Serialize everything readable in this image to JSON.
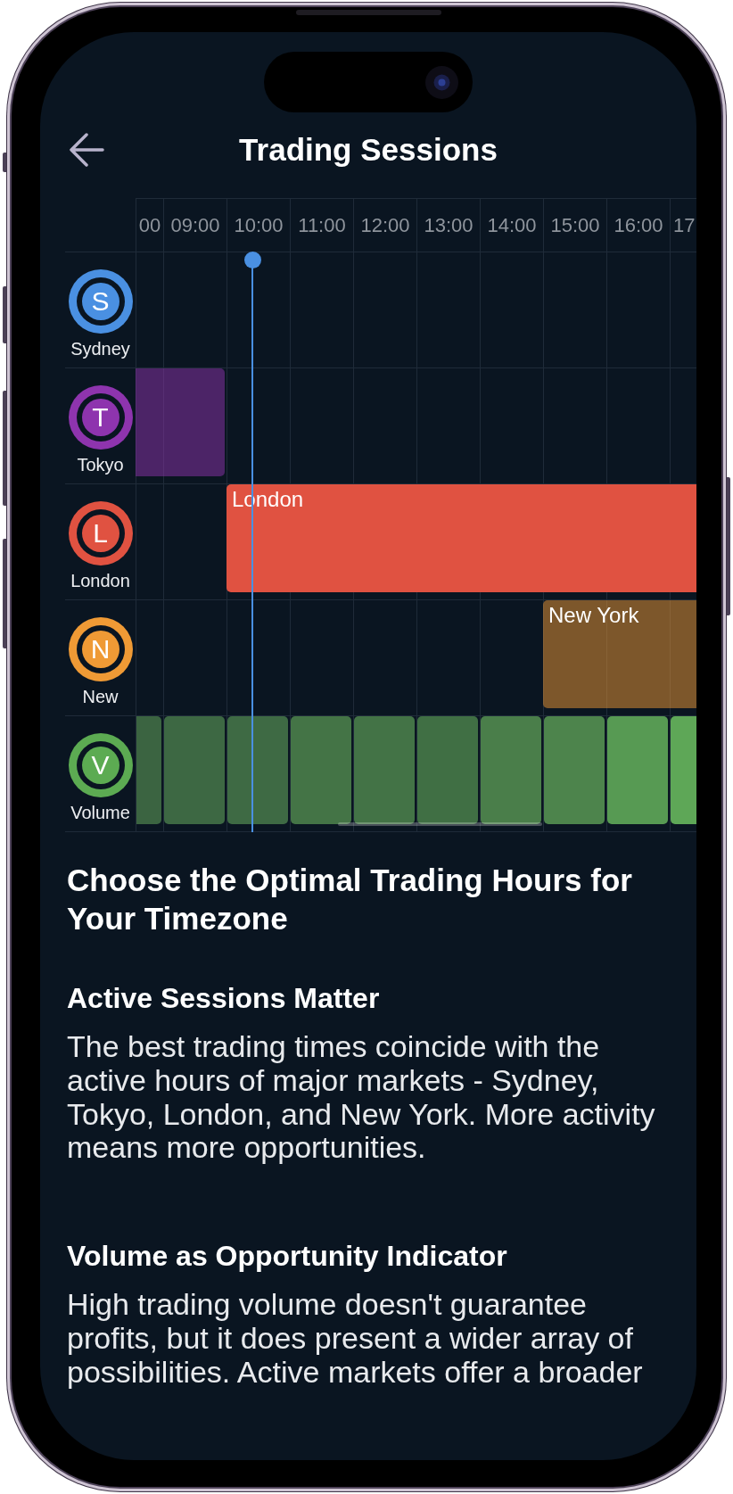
{
  "screen": {
    "title": "Trading Sessions"
  },
  "timeline": {
    "hours": [
      {
        "label": "00",
        "now": false
      },
      {
        "label": "09:00",
        "now": false
      },
      {
        "label": "10:00",
        "now": true
      },
      {
        "label": "11:00",
        "now": false
      },
      {
        "label": "12:00",
        "now": false
      },
      {
        "label": "13:00",
        "now": false
      },
      {
        "label": "14:00",
        "now": false
      },
      {
        "label": "15:00",
        "now": false
      },
      {
        "label": "16:00",
        "now": false
      },
      {
        "label": "17",
        "now": false
      }
    ],
    "rows": [
      {
        "kind": "session",
        "letter": "S",
        "name": "Sydney",
        "color": "#4a90e2",
        "active": [
          false,
          false,
          false,
          false,
          false,
          false,
          false,
          false,
          false,
          false
        ]
      },
      {
        "kind": "session",
        "letter": "T",
        "name": "Tokyo",
        "color": "#8e34ae",
        "open_now": false,
        "active": [
          true,
          true,
          false,
          false,
          false,
          false,
          false,
          false,
          false,
          false
        ]
      },
      {
        "kind": "session",
        "letter": "L",
        "name": "London",
        "color": "#e05241",
        "open_now": true,
        "bar_label": "London",
        "active": [
          false,
          false,
          true,
          true,
          true,
          true,
          true,
          true,
          true,
          true
        ]
      },
      {
        "kind": "session",
        "letter": "N",
        "name": "New",
        "color": "#ef9a35",
        "open_now": false,
        "bar_label": "New York",
        "active": [
          false,
          false,
          false,
          false,
          false,
          false,
          false,
          true,
          true,
          true
        ]
      },
      {
        "kind": "volume",
        "letter": "V",
        "name": "Volume",
        "color": "#5cab52",
        "segments": [
          {
            "color": "#3b6441"
          },
          {
            "color": "#3d6843"
          },
          {
            "color": "#3e6a44"
          },
          {
            "color": "#447446"
          },
          {
            "color": "#437346"
          },
          {
            "color": "#406f44"
          },
          {
            "color": "#4a7e4a"
          },
          {
            "color": "#4d844c"
          },
          {
            "color": "#579a53"
          },
          {
            "color": "#5ea757"
          }
        ]
      }
    ]
  },
  "article": {
    "heading": "Choose the Optimal Trading Hours for Your Timezone",
    "sections": [
      {
        "title": "Active Sessions Matter",
        "body": "The best trading times coincide with the active hours of major markets - Sydney, Tokyo, London, and New York. More activity means more opportunities."
      },
      {
        "title": "Volume as Opportunity Indicator",
        "body": "High trading volume doesn't guarantee profits, but it does present a wider array of possibilities. Active markets offer a broader"
      }
    ]
  }
}
